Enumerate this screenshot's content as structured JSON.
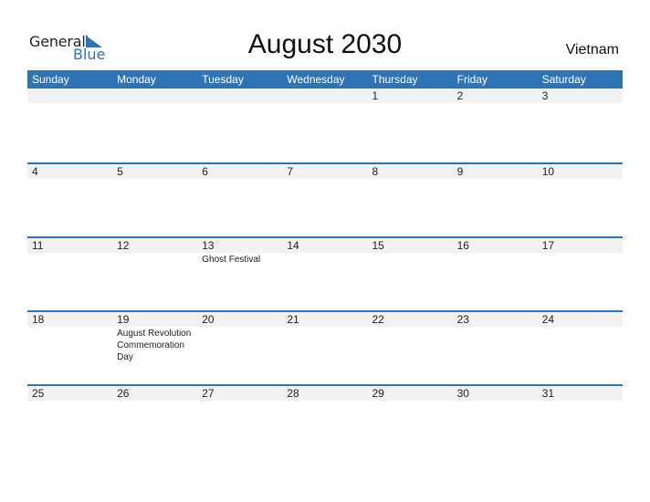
{
  "logo": {
    "line1": "General",
    "line2": "Blue"
  },
  "title": "August 2030",
  "country": "Vietnam",
  "weekdays": [
    "Sunday",
    "Monday",
    "Tuesday",
    "Wednesday",
    "Thursday",
    "Friday",
    "Saturday"
  ],
  "weeks": [
    {
      "days": [
        {
          "num": "",
          "event": ""
        },
        {
          "num": "",
          "event": ""
        },
        {
          "num": "",
          "event": ""
        },
        {
          "num": "",
          "event": ""
        },
        {
          "num": "1",
          "event": ""
        },
        {
          "num": "2",
          "event": ""
        },
        {
          "num": "3",
          "event": ""
        }
      ]
    },
    {
      "days": [
        {
          "num": "4",
          "event": ""
        },
        {
          "num": "5",
          "event": ""
        },
        {
          "num": "6",
          "event": ""
        },
        {
          "num": "7",
          "event": ""
        },
        {
          "num": "8",
          "event": ""
        },
        {
          "num": "9",
          "event": ""
        },
        {
          "num": "10",
          "event": ""
        }
      ]
    },
    {
      "days": [
        {
          "num": "11",
          "event": ""
        },
        {
          "num": "12",
          "event": ""
        },
        {
          "num": "13",
          "event": "Ghost Festival"
        },
        {
          "num": "14",
          "event": ""
        },
        {
          "num": "15",
          "event": ""
        },
        {
          "num": "16",
          "event": ""
        },
        {
          "num": "17",
          "event": ""
        }
      ]
    },
    {
      "days": [
        {
          "num": "18",
          "event": ""
        },
        {
          "num": "19",
          "event": "August Revolution Commemoration Day"
        },
        {
          "num": "20",
          "event": ""
        },
        {
          "num": "21",
          "event": ""
        },
        {
          "num": "22",
          "event": ""
        },
        {
          "num": "23",
          "event": ""
        },
        {
          "num": "24",
          "event": ""
        }
      ]
    },
    {
      "days": [
        {
          "num": "25",
          "event": ""
        },
        {
          "num": "26",
          "event": ""
        },
        {
          "num": "27",
          "event": ""
        },
        {
          "num": "28",
          "event": ""
        },
        {
          "num": "29",
          "event": ""
        },
        {
          "num": "30",
          "event": ""
        },
        {
          "num": "31",
          "event": ""
        }
      ]
    }
  ],
  "colors": {
    "accent": "#2e74b5",
    "strip": "#f2f2f2"
  }
}
